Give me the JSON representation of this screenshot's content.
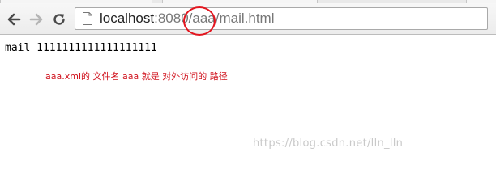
{
  "browser": {
    "address_bar": {
      "host": "localhost",
      "port_suffix": ":8080",
      "path_highlighted": "/aaa",
      "path_rest": "/mail.html"
    },
    "icons": {
      "back": "back-arrow-icon",
      "forward": "forward-arrow-icon",
      "reload": "reload-icon",
      "page": "page-icon"
    }
  },
  "page": {
    "body_text": "mail 1111111111111111111"
  },
  "annotation": {
    "note": "aaa.xml的 文件名 aaa 就是 对外访问的 路径",
    "circle_color": "#e3161f",
    "note_color": "#d0101b"
  },
  "watermark": {
    "text": "https://blog.csdn.net/lln_lln"
  }
}
